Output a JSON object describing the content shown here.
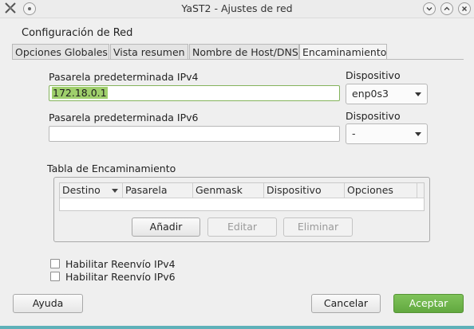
{
  "window": {
    "title": "YaST2 - Ajustes de red",
    "icons": [
      "yast-logo-icon",
      "pin-icon",
      "minimize-icon",
      "maximize-icon",
      "close-icon"
    ]
  },
  "header": {
    "title": "Configuración de Red"
  },
  "tabs": [
    {
      "label": "Opciones Globales",
      "active": false
    },
    {
      "label": "Vista resumen",
      "active": false
    },
    {
      "label": "Nombre de Host/DNS",
      "active": false
    },
    {
      "label": "Encaminamiento",
      "active": true
    }
  ],
  "gateway_ipv4": {
    "label": "Pasarela predeterminada IPv4",
    "value": "172.18.0.1",
    "device_label": "Dispositivo",
    "device_value": "enp0s3"
  },
  "gateway_ipv6": {
    "label": "Pasarela predeterminada IPv6",
    "value": "",
    "device_label": "Dispositivo",
    "device_value": "-"
  },
  "routing_table": {
    "title": "Tabla de Encaminamiento",
    "columns": [
      "Destino",
      "Pasarela",
      "Genmask",
      "Dispositivo",
      "Opciones"
    ],
    "rows": []
  },
  "table_buttons": {
    "add": "Añadir",
    "edit": "Editar",
    "delete": "Eliminar"
  },
  "forwarding": {
    "ipv4": {
      "label": "Habilitar Reenvío IPv4",
      "checked": false
    },
    "ipv6": {
      "label": "Habilitar Reenvío IPv6",
      "checked": false
    }
  },
  "footer": {
    "help": "Ayuda",
    "cancel": "Cancelar",
    "accept": "Aceptar"
  },
  "colors": {
    "accent": "#6cb548",
    "selection": "#9fcf6c"
  }
}
